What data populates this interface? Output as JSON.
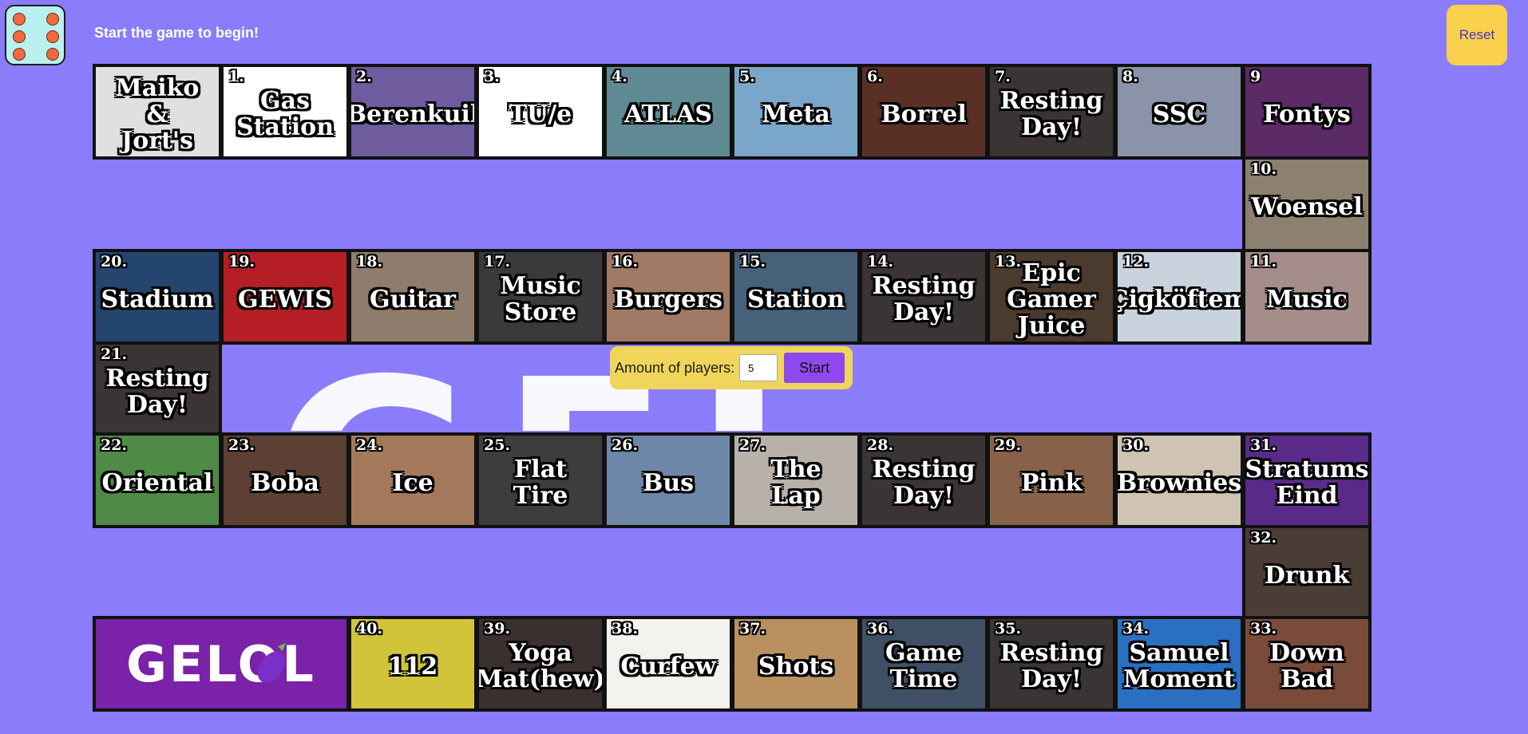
{
  "status": "Start the game to begin!",
  "reset_label": "Reset",
  "die": {
    "value": 6
  },
  "players": {
    "label": "Amount of players:",
    "value": "5",
    "start_label": "Start"
  },
  "logo": {
    "text": "GELOL"
  },
  "watermark": {
    "text": "GEL"
  },
  "rows": [
    [
      {
        "num": "",
        "label": "Maiko\n&\nJort's",
        "color": "#dfe0e2"
      },
      {
        "num": "1.",
        "label": "Gas\nStation",
        "color": "#ffffff"
      },
      {
        "num": "2.",
        "label": "Berenkuil",
        "color": "#6f5c9e"
      },
      {
        "num": "3.",
        "label": "TU/e",
        "color": "#ffffff"
      },
      {
        "num": "4.",
        "label": "ATLAS",
        "color": "#5f8a94"
      },
      {
        "num": "5.",
        "label": "Meta",
        "color": "#7aa7c9"
      },
      {
        "num": "6.",
        "label": "Borrel",
        "color": "#5a3026"
      },
      {
        "num": "7.",
        "label": "Resting\nDay!",
        "color": "#3a3434"
      },
      {
        "num": "8.",
        "label": "SSC",
        "color": "#8b93a8"
      },
      {
        "num": "9",
        "label": "Fontys",
        "color": "#5b2a67"
      }
    ],
    [
      {
        "num": "10.",
        "label": "Woensel",
        "color": "#8c8070"
      }
    ],
    [
      {
        "num": "20.",
        "label": "Stadium",
        "color": "#24456e"
      },
      {
        "num": "19.",
        "label": "GEWIS",
        "color": "#b41e24"
      },
      {
        "num": "18.",
        "label": "Guitar",
        "color": "#8e7c6c"
      },
      {
        "num": "17.",
        "label": "Music\nStore",
        "color": "#3b3a3a"
      },
      {
        "num": "16.",
        "label": "Burgers",
        "color": "#a07a64"
      },
      {
        "num": "15.",
        "label": "Station",
        "color": "#47617a"
      },
      {
        "num": "14.",
        "label": "Resting\nDay!",
        "color": "#3a3434"
      },
      {
        "num": "13.",
        "label": "Epic\nGamer\nJuice",
        "color": "#4b3a2e"
      },
      {
        "num": "12.",
        "label": "Çigköftem",
        "color": "#c9d3de"
      },
      {
        "num": "11.",
        "label": "Music",
        "color": "#a58d8a"
      }
    ],
    [
      {
        "num": "21.",
        "label": "Resting\nDay!",
        "color": "#3a3434"
      }
    ],
    [
      {
        "num": "22.",
        "label": "Oriental",
        "color": "#4f8a46"
      },
      {
        "num": "23.",
        "label": "Boba",
        "color": "#5c4033"
      },
      {
        "num": "24.",
        "label": "Ice",
        "color": "#a27a5b"
      },
      {
        "num": "25.",
        "label": "Flat\nTire",
        "color": "#3d3d3d"
      },
      {
        "num": "26.",
        "label": "Bus",
        "color": "#6e86a8"
      },
      {
        "num": "27.",
        "label": "The\nLap",
        "color": "#b7b1a9"
      },
      {
        "num": "28.",
        "label": "Resting\nDay!",
        "color": "#3a3434"
      },
      {
        "num": "29.",
        "label": "Pink",
        "color": "#87614a"
      },
      {
        "num": "30.",
        "label": "Brownies",
        "color": "#cfc3b3"
      },
      {
        "num": "31.",
        "label": "Stratums\nEind",
        "color": "#5a2a8a"
      }
    ],
    [
      {
        "num": "32.",
        "label": "Drunk",
        "color": "#4a3d36"
      }
    ],
    [
      {
        "num": "40.",
        "label": "112",
        "color": "#d2c43a"
      },
      {
        "num": "39.",
        "label": "Yoga\nMat(hew)",
        "color": "#3a3030"
      },
      {
        "num": "38.",
        "label": "Curfew",
        "color": "#f4f2ee"
      },
      {
        "num": "37.",
        "label": "Shots",
        "color": "#b99160"
      },
      {
        "num": "36.",
        "label": "Game\nTime",
        "color": "#3e4f66"
      },
      {
        "num": "35.",
        "label": "Resting\nDay!",
        "color": "#3a3434"
      },
      {
        "num": "34.",
        "label": "Samuel\nMoment",
        "color": "#2a6fc0"
      },
      {
        "num": "33.",
        "label": "Down\nBad",
        "color": "#7a4b3a"
      }
    ]
  ]
}
